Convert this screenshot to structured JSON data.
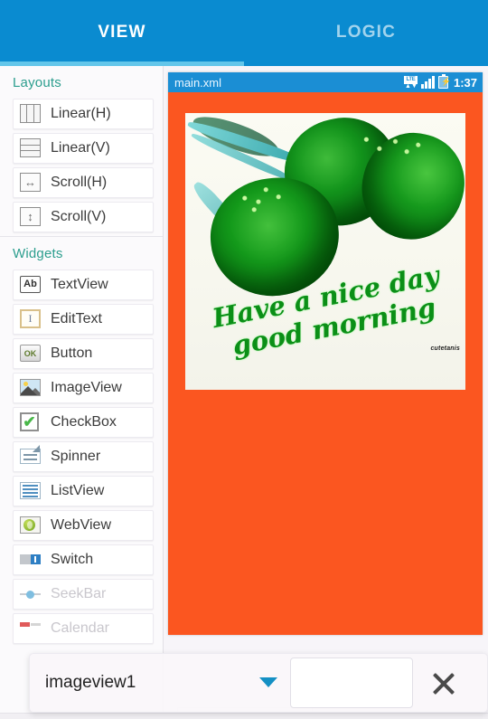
{
  "app": {
    "accent_blue": "#0a8bd0",
    "indicator_blue": "#63c6ea",
    "section_title_color": "#2c9e8e",
    "canvas_background": "#fb5620"
  },
  "tabs": [
    {
      "label": "VIEW",
      "active": true
    },
    {
      "label": "LOGIC",
      "active": false
    }
  ],
  "palette": {
    "sections": [
      {
        "title": "Layouts",
        "items": [
          {
            "label": "Linear(H)",
            "icon": "linear-horizontal-icon"
          },
          {
            "label": "Linear(V)",
            "icon": "linear-vertical-icon"
          },
          {
            "label": "Scroll(H)",
            "icon": "scroll-horizontal-icon"
          },
          {
            "label": "Scroll(V)",
            "icon": "scroll-vertical-icon"
          }
        ]
      },
      {
        "title": "Widgets",
        "items": [
          {
            "label": "TextView",
            "icon": "textview-icon"
          },
          {
            "label": "EditText",
            "icon": "edittext-icon"
          },
          {
            "label": "Button",
            "icon": "button-icon"
          },
          {
            "label": "ImageView",
            "icon": "imageview-icon"
          },
          {
            "label": "CheckBox",
            "icon": "checkbox-icon"
          },
          {
            "label": "Spinner",
            "icon": "spinner-icon"
          },
          {
            "label": "ListView",
            "icon": "listview-icon"
          },
          {
            "label": "WebView",
            "icon": "webview-icon"
          },
          {
            "label": "Switch",
            "icon": "switch-icon"
          },
          {
            "label": "SeekBar",
            "icon": "seekbar-icon"
          },
          {
            "label": "Calendar",
            "icon": "calendar-icon"
          }
        ]
      }
    ],
    "icon_glyphs": {
      "textview": "Ab",
      "edittext": "I",
      "button": "OK",
      "checkbox": "✔",
      "scroll_h": "↔",
      "scroll_v": "↕"
    }
  },
  "preview": {
    "statusbar": {
      "title": "main.xml",
      "network_label": "LTE",
      "time": "1:37",
      "icons": [
        "lte-icon",
        "signal-icon",
        "battery-icon"
      ]
    },
    "card": {
      "line1": "Have a nice day",
      "line2": "good morning",
      "watermark": "cutetanis"
    }
  },
  "overlay": {
    "selected_view": "imageview1",
    "input_value": "",
    "input_placeholder": "",
    "close_label": "✕"
  }
}
